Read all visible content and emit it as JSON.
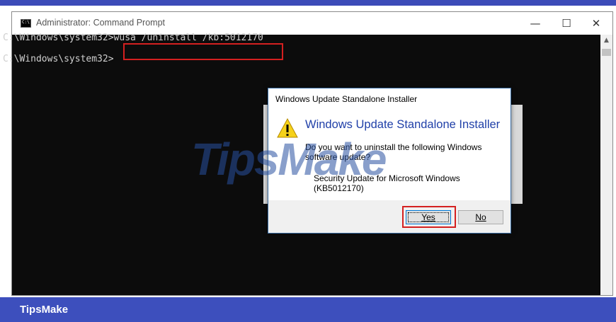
{
  "window": {
    "title": "Administrator: Command Prompt",
    "minimize_glyph": "—",
    "maximize_glyph": "☐",
    "close_glyph": "✕"
  },
  "console": {
    "line1_prompt": "C:\\Windows\\system32>",
    "line1_command": "wusa /uninstall /kb:5012170",
    "line2_prompt": "C:\\Windows\\system32>"
  },
  "dialog": {
    "title": "Windows Update Standalone Installer",
    "heading": "Windows Update Standalone Installer",
    "question": "Do you want to uninstall the following Windows software update?",
    "update_name": "Security Update for Microsoft Windows (KB5012170)",
    "yes_label": "Yes",
    "no_label": "No"
  },
  "watermark": "TipsMake",
  "footer": {
    "brand": "TipsMake"
  },
  "colors": {
    "brand_bar": "#3d4fbd",
    "highlight": "#d42020",
    "dialog_heading": "#1f3fa8"
  }
}
